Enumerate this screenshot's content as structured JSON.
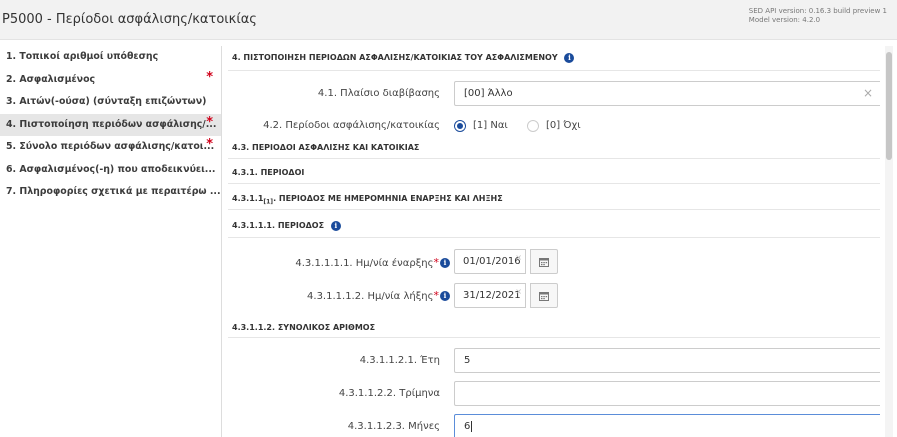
{
  "header": {
    "title": "Ρ5000 - Περίοδοι ασφάλισης/κατοικίας",
    "version_line1": "SED API version: 0.16.3 build preview 1",
    "version_line2": "Model version: 4.2.0"
  },
  "sidebar": {
    "items": [
      {
        "label": "1. Τοπικοί αριθμοί υπόθεσης",
        "required": ""
      },
      {
        "label": "2. Ασφαλισμένος",
        "required": "*"
      },
      {
        "label": "3. Αιτών(-ούσα) (σύνταξη επιζώντων)",
        "required": ""
      },
      {
        "label": "4. Πιστοποίηση περιόδων ασφάλισης/...",
        "required": "*"
      },
      {
        "label": "5. Σύνολο περιόδων ασφάλισης/κατοι...",
        "required": "*"
      },
      {
        "label": "6. Ασφαλισμένος(-η) που αποδεικνύει...",
        "required": ""
      },
      {
        "label": "7. Πληροφορίες σχετικά με περαιτέρω ...",
        "required": ""
      }
    ]
  },
  "main": {
    "section4_title": "4. ΠΙΣΤΟΠΟΙΗΣΗ ΠΕΡΙΟΔΩΝ ΑΣΦΑΛΙΣΗΣ/ΚΑΤΟΙΚΙΑΣ ΤΟΥ ΑΣΦΑΛΙΣΜΕΝΟΥ",
    "field_4_1_label": "4.1. Πλαίσιο διαβίβασης",
    "field_4_1_value": "[00] Άλλο",
    "field_4_2_label": "4.2. Περίοδοι ασφάλισης/κατοικίας",
    "radio_yes": "[1] Ναι",
    "radio_no": "[0] Όχι",
    "section_4_3": "4.3. ΠΕΡΙΟΔΟΙ ΑΣΦΑΛΙΣΗΣ ΚΑΙ ΚΑΤΟΙΚΙΑΣ",
    "section_4_3_1": "4.3.1. ΠΕΡΙΟΔΟΙ",
    "section_4_3_1_1_prefix": "4.3.1.1",
    "section_4_3_1_1_sub": "[1]",
    "section_4_3_1_1_suffix": ". ΠΕΡΙΟΔΟΣ ΜΕ ΗΜΕΡΟΜΗΝΙΑ ΕΝΑΡΞΗΣ ΚΑΙ ΛΗΞΗΣ",
    "section_4_3_1_1_1": "4.3.1.1.1. ΠΕΡΙΟΔΟΣ",
    "start_label": "4.3.1.1.1.1. Ημ/νία έναρξης",
    "start_value": "01/01/2016",
    "end_label": "4.3.1.1.1.2. Ημ/νία λήξης",
    "end_value": "31/12/2021",
    "section_4_3_1_1_2": "4.3.1.1.2. ΣΥΝΟΛΙΚΟΣ ΑΡΙΘΜΟΣ",
    "years_label": "4.3.1.1.2.1. Έτη",
    "years_value": "5",
    "quarters_label": "4.3.1.1.2.2. Τρίμηνα",
    "quarters_value": "",
    "months_label": "4.3.1.1.2.3. Μήνες",
    "months_value": "6"
  },
  "icons": {
    "info": "i",
    "clear": "×",
    "required": "*"
  },
  "colors": {
    "accent": "#1a4b9b",
    "required": "#d0021b"
  }
}
